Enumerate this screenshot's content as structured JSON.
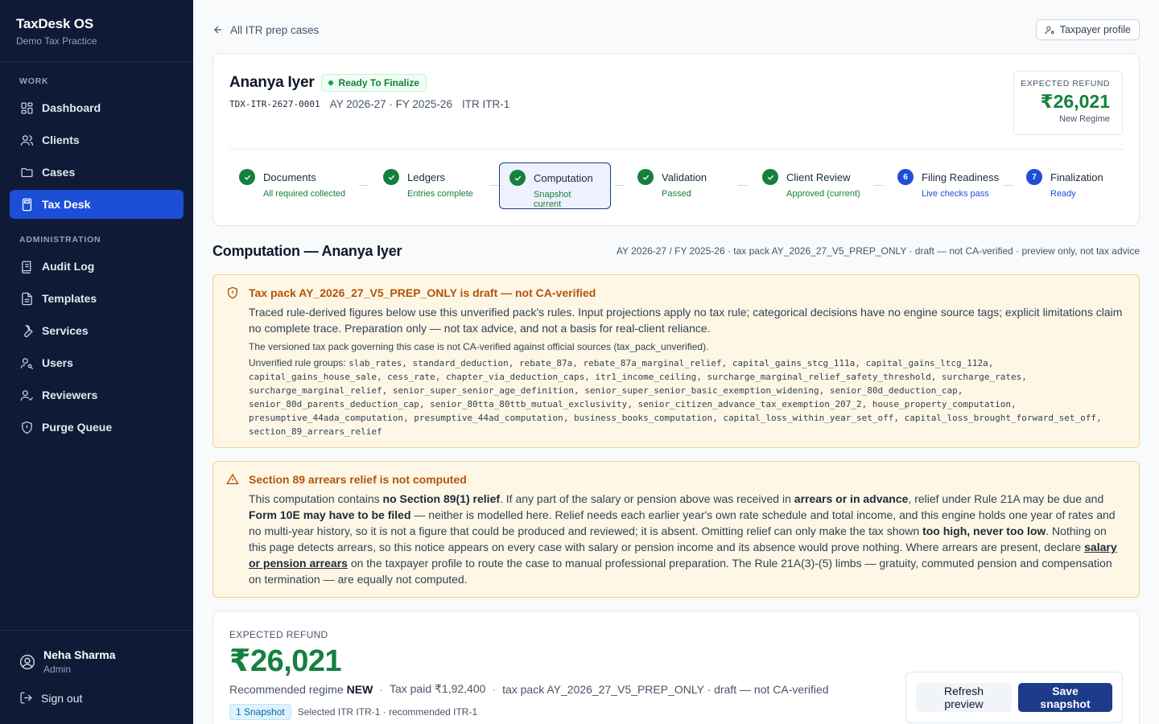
{
  "sidebar": {
    "brand_title": "TaxDesk OS",
    "brand_sub": "Demo Tax Practice",
    "section_work": "WORK",
    "section_admin": "ADMINISTRATION",
    "items": [
      {
        "label": "Dashboard",
        "icon": "dashboard-icon"
      },
      {
        "label": "Clients",
        "icon": "users-icon"
      },
      {
        "label": "Cases",
        "icon": "folder-icon"
      },
      {
        "label": "Tax Desk",
        "icon": "calculator-icon"
      },
      {
        "label": "Audit Log",
        "icon": "log-icon"
      },
      {
        "label": "Templates",
        "icon": "document-icon"
      },
      {
        "label": "Services",
        "icon": "wrench-icon"
      },
      {
        "label": "Users",
        "icon": "user-key-icon"
      },
      {
        "label": "Reviewers",
        "icon": "user-check-icon"
      },
      {
        "label": "Purge Queue",
        "icon": "shield-icon"
      }
    ],
    "active": "Tax Desk",
    "user_name": "Neha Sharma",
    "user_role": "Admin",
    "signout": "Sign out"
  },
  "topbar": {
    "back_label": "All ITR prep cases",
    "profile_button": "Taxpayer profile"
  },
  "case": {
    "name": "Ananya Iyer",
    "status": "Ready To Finalize",
    "case_id": "TDX-ITR-2627-0001",
    "years": "AY 2026-27 · FY 2025-26",
    "form": "ITR ITR-1",
    "refund_label": "EXPECTED REFUND",
    "refund_amount": "₹26,021",
    "refund_regime": "New Regime"
  },
  "steps": [
    {
      "name": "Documents",
      "sub": "All required collected",
      "state": "done"
    },
    {
      "name": "Ledgers",
      "sub": "Entries complete",
      "state": "done"
    },
    {
      "name": "Computation",
      "sub": "Snapshot current",
      "state": "active"
    },
    {
      "name": "Validation",
      "sub": "Passed",
      "state": "done"
    },
    {
      "name": "Client Review",
      "sub": "Approved (current)",
      "state": "done"
    },
    {
      "name": "Filing Readiness",
      "sub": "Live checks pass",
      "state": "pending",
      "num": "6"
    },
    {
      "name": "Finalization",
      "sub": "Ready",
      "state": "pending",
      "num": "7"
    }
  ],
  "computation": {
    "title": "Computation — Ananya Iyer",
    "meta": "AY 2026-27 / FY 2025-26 · tax pack AY_2026_27_V5_PREP_ONLY · draft — not CA-verified · preview only, not tax advice"
  },
  "warning_pack": {
    "title": "Tax pack AY_2026_27_V5_PREP_ONLY is draft — not CA-verified",
    "body": "Traced rule-derived figures below use this unverified pack's rules. Input projections apply no tax rule; categorical decisions have no engine source tags; explicit limitations claim no complete trace. Preparation only — not tax advice, and not a basis for real-client reliance.",
    "note": "The versioned tax pack governing this case is not CA-verified against official sources (tax_pack_unverified).",
    "groups_label": "Unverified rule groups:",
    "groups_first": "slab_rates, standard_deduction, rebate_87a, rebate_87a_marginal_relief, capital_gains_stcg_111a, capital_gains_ltcg_112a,",
    "groups_rest": [
      "capital_gains_house_sale, cess_rate, chapter_via_deduction_caps, itr1_income_ceiling, surcharge_marginal_relief_safety_threshold, surcharge_rates,",
      "surcharge_marginal_relief, senior_super_senior_age_definition, senior_super_senior_basic_exemption_widening, senior_80d_deduction_cap,",
      "senior_80d_parents_deduction_cap, senior_80tta_80ttb_mutual_exclusivity, senior_citizen_advance_tax_exemption_207_2, house_property_computation,",
      "presumptive_44ada_computation, presumptive_44ad_computation, business_books_computation, capital_loss_within_year_set_off, capital_loss_brought_forward_set_off,",
      "section_89_arrears_relief"
    ]
  },
  "warning_s89": {
    "title": "Section 89 arrears relief is not computed",
    "t1": "This computation contains ",
    "b1": "no Section 89(1) relief",
    "t2": ". If any part of the salary or pension above was received in ",
    "b2": "arrears or in advance",
    "t3": ", relief under Rule 21A may be due and ",
    "b3": "Form 10E may have to be filed",
    "t4": " — neither is modelled here. Relief needs each earlier year's own rate schedule and total income, and this engine holds one year of rates and no multi-year history, so it is not a figure that could be produced and reviewed; it is absent. Omitting relief can only make the tax shown ",
    "b4": "too high, never too low",
    "t5": ". Nothing on this page detects arrears, so this notice appears on every case with salary or pension income and its absence would prove nothing. Where arrears are present, declare ",
    "link": "salary or pension arrears",
    "t6": " on the taxpayer profile to route the case to manual professional preparation. The Rule 21A(3)-(5) limbs — gratuity, commuted pension and compensation on termination — are equally not computed."
  },
  "summary": {
    "label": "EXPECTED REFUND",
    "amount": "₹26,021",
    "regime_label": "Recommended regime",
    "regime_value": "NEW",
    "tax_paid": "Tax paid ₹1,92,400",
    "pack": "tax pack AY_2026_27_V5_PREP_ONLY · draft — not CA-verified",
    "snapshot_chip": "1 Snapshot",
    "itr_note": "Selected ITR ITR-1 · recommended ITR-1",
    "refresh_button": "Refresh preview",
    "save_button": "Save snapshot"
  }
}
